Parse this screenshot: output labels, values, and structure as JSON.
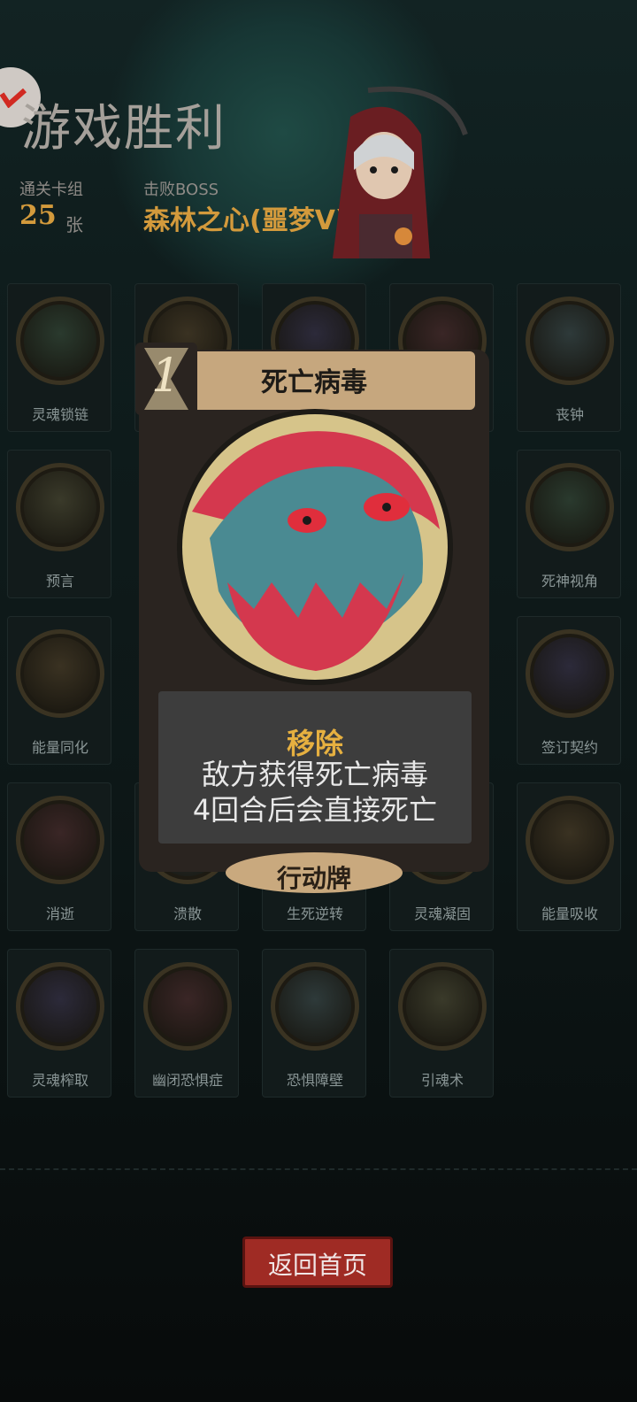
{
  "header": {
    "title": "游戏胜利",
    "deck_label": "通关卡组",
    "deck_count": "25",
    "deck_unit": "张",
    "boss_label": "击败BOSS",
    "boss_name": "森林之心(噩梦V)"
  },
  "cards": [
    {
      "label": "灵魂锁链",
      "icon": "chain-icon"
    },
    {
      "label": "",
      "icon": "hourglass-icon"
    },
    {
      "label": "",
      "icon": "witch-icon"
    },
    {
      "label": "",
      "icon": "explosion-icon"
    },
    {
      "label": "丧钟",
      "icon": "bell-icon"
    },
    {
      "label": "预言",
      "icon": "prophet-icon"
    },
    {
      "label": "死神视角",
      "icon": "reaper-eye-icon"
    },
    {
      "label": "能量同化",
      "icon": "energy-icon"
    },
    {
      "label": "签订契约",
      "icon": "contract-icon"
    },
    {
      "label": "消逝",
      "icon": "vanish-icon"
    },
    {
      "label": "溃散",
      "icon": "scatter-icon"
    },
    {
      "label": "生死逆转",
      "icon": "reverse-icon"
    },
    {
      "label": "灵魂凝固",
      "icon": "soul-freeze-icon"
    },
    {
      "label": "能量吸收",
      "icon": "absorb-icon"
    },
    {
      "label": "灵魂榨取",
      "icon": "soul-drain-icon"
    },
    {
      "label": "幽闭恐惧症",
      "icon": "claustrophobia-icon"
    },
    {
      "label": "恐惧障壁",
      "icon": "fear-barrier-icon"
    },
    {
      "label": "引魂术",
      "icon": "soul-summon-icon"
    }
  ],
  "detail_card": {
    "cost": "1",
    "name": "死亡病毒",
    "keyword": "移除",
    "desc_line1": "敌方获得死亡病毒",
    "desc_line2": "4回合后会直接死亡",
    "type": "行动牌"
  },
  "footer": {
    "back_label": "返回首页"
  },
  "colors": {
    "accent": "#d39a3c",
    "button": "#9f2b24",
    "card_plank": "#c6a77e"
  }
}
